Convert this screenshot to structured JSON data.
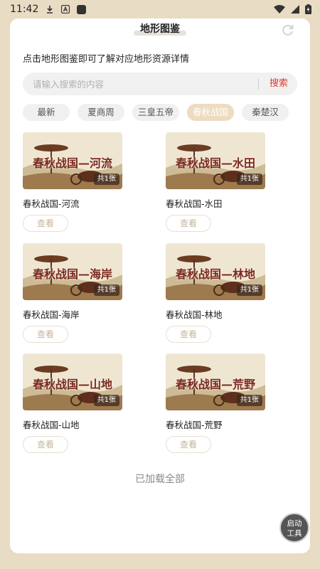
{
  "status_bar": {
    "time": "11:42"
  },
  "header": {
    "title": "地形图鉴"
  },
  "intro_text": "点击地形图鉴即可了解对应地形资源详情",
  "search": {
    "placeholder": "请输入搜索的内容",
    "value": "",
    "button_label": "搜索"
  },
  "tabs": [
    {
      "label": "最新",
      "active": false
    },
    {
      "label": "夏商周",
      "active": false
    },
    {
      "label": "三皇五帝",
      "active": false
    },
    {
      "label": "春秋战国",
      "active": true
    },
    {
      "label": "秦楚汉",
      "active": false
    }
  ],
  "items": [
    {
      "thumb_title": "春秋战国—河流",
      "count": "共1张",
      "name": "春秋战国-河流",
      "button": "查看"
    },
    {
      "thumb_title": "春秋战国—水田",
      "count": "共1张",
      "name": "春秋战国-水田",
      "button": "查看"
    },
    {
      "thumb_title": "春秋战国—海岸",
      "count": "共1张",
      "name": "春秋战国-海岸",
      "button": "查看"
    },
    {
      "thumb_title": "春秋战国—林地",
      "count": "共1张",
      "name": "春秋战国-林地",
      "button": "查看"
    },
    {
      "thumb_title": "春秋战国—山地",
      "count": "共1张",
      "name": "春秋战国-山地",
      "button": "查看"
    },
    {
      "thumb_title": "春秋战国—荒野",
      "count": "共1张",
      "name": "春秋战国-荒野",
      "button": "查看"
    }
  ],
  "footer": {
    "loaded_all": "已加载全部"
  },
  "tool_button": {
    "line1": "启动",
    "line2": "工具"
  },
  "colors": {
    "background": "#e9dcc4",
    "accent_red": "#e03a2e",
    "active_tab": "#eddcc0"
  }
}
